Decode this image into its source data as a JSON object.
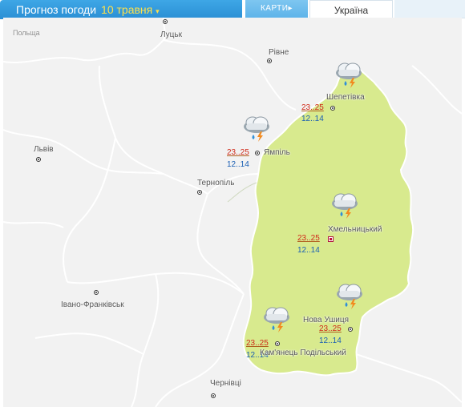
{
  "header": {
    "title": "Прогноз погоди",
    "date": "10 травня",
    "caret": "▾",
    "maps_label": "КАРТИ",
    "maps_arrow": "▸",
    "region": "Україна"
  },
  "colors": {
    "header_blue": "#2a8fd4",
    "date_yellow": "#ffe04a",
    "region_fill": "#d8ea8e",
    "day_temp": "#d02a1a",
    "night_temp": "#1a5fb4"
  },
  "map": {
    "country_labels": [
      {
        "name": "Польща"
      }
    ],
    "cities": [
      {
        "name": "Луцьк"
      },
      {
        "name": "Рівне"
      },
      {
        "name": "Львів"
      },
      {
        "name": "Тернопіль"
      },
      {
        "name": "Івано-Франківськ"
      },
      {
        "name": "Чернівці"
      }
    ],
    "forecast_points": [
      {
        "name": "Шепетівка",
        "day": "23..25",
        "night": "12..14",
        "icon": "cloud-rain-thunder-icon"
      },
      {
        "name": "Ямпіль",
        "day": "23..25",
        "night": "12..14",
        "icon": "cloud-rain-thunder-icon"
      },
      {
        "name": "Хмельницький",
        "day": "23..25",
        "night": "12..14",
        "icon": "cloud-rain-thunder-icon"
      },
      {
        "name": "Нова Ушиця",
        "day": "23..25",
        "night": "12..14",
        "icon": "cloud-rain-thunder-icon"
      },
      {
        "name": "Кам'янець Подільський",
        "day": "23..25",
        "night": "12..14",
        "icon": "cloud-rain-thunder-icon"
      }
    ]
  }
}
